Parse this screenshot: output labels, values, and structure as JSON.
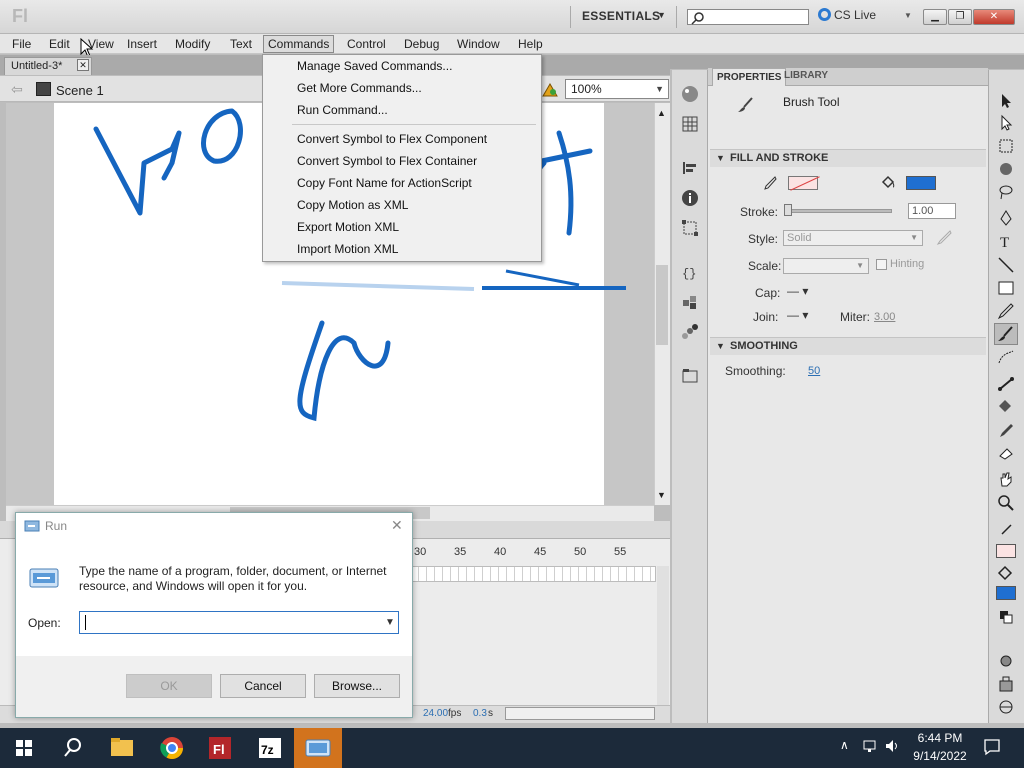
{
  "app": {
    "logo": "Fl",
    "workspace": "ESSENTIALS",
    "cs_live": "CS Live",
    "window_controls": [
      "minimize-icon",
      "restore-icon",
      "close-icon"
    ]
  },
  "menubar": [
    "File",
    "Edit",
    "View",
    "Insert",
    "Modify",
    "Text",
    "Commands",
    "Control",
    "Debug",
    "Window",
    "Help"
  ],
  "document": {
    "tab": "Untitled-3*",
    "scene": "Scene 1",
    "zoom": "100%"
  },
  "commands_menu": {
    "group1": [
      "Manage Saved Commands...",
      "Get More Commands...",
      "Run Command..."
    ],
    "group2": [
      "Convert Symbol to Flex Component",
      "Convert Symbol to Flex Container",
      "Copy Font Name for ActionScript",
      "Copy Motion as XML",
      "Export Motion XML",
      "Import Motion XML"
    ]
  },
  "timeline": {
    "frame_numbers": [
      "30",
      "35",
      "40",
      "45",
      "50",
      "55"
    ],
    "fps": "24.00",
    "fps_unit": "fps",
    "seconds": "0.3",
    "seconds_unit": "s"
  },
  "properties": {
    "tabs": [
      "PROPERTIES",
      "LIBRARY"
    ],
    "tool_name": "Brush Tool",
    "fill_stroke": {
      "title": "FILL AND STROKE",
      "stroke_label": "Stroke:",
      "stroke_value": "1.00",
      "style_label": "Style:",
      "style_value": "Solid",
      "scale_label": "Scale:",
      "hinting_label": "Hinting",
      "cap_label": "Cap:",
      "join_label": "Join:",
      "miter_label": "Miter:",
      "miter_value": "3.00",
      "fill_color": "#1f6fd1"
    },
    "smoothing": {
      "title": "SMOOTHING",
      "label": "Smoothing:",
      "value": "50"
    }
  },
  "run_dialog": {
    "title": "Run",
    "description": "Type the name of a program, folder, document, or Internet resource, and Windows will open it for you.",
    "open_label": "Open:",
    "input_value": "",
    "ok": "OK",
    "cancel": "Cancel",
    "browse": "Browse..."
  },
  "taskbar": {
    "time": "6:44 PM",
    "date": "9/14/2022",
    "items": [
      "start-icon",
      "search-icon",
      "file-explorer-icon",
      "chrome-icon",
      "flash-icon",
      "7zip-icon",
      "run-icon"
    ]
  }
}
